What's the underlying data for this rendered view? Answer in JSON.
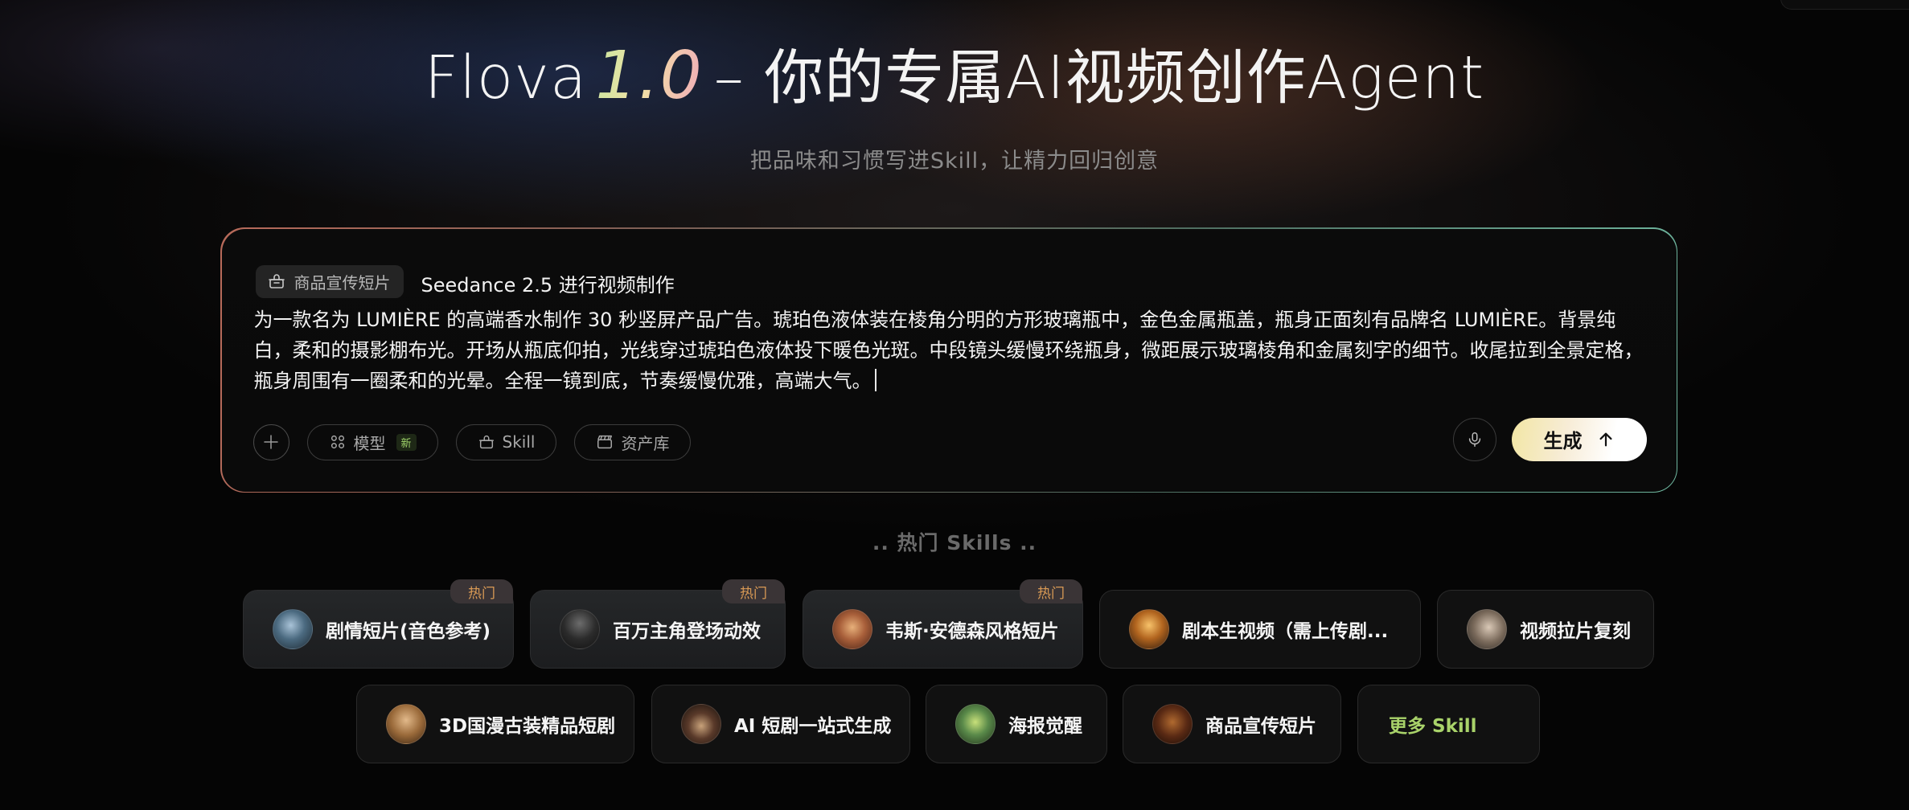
{
  "hero": {
    "brand": "Flova",
    "version": "1.0",
    "tagline": "– 你的专属AI视频创作Agent",
    "subtitle": "把品味和习惯写进Skill，让精力回归创意"
  },
  "composer": {
    "skill_chip": "商品宣传短片",
    "model_line": "Seedance 2.5 进行视频制作",
    "prompt": "为一款名为 LUMIÈRE 的高端香水制作 30 秒竖屏产品广告。琥珀色液体装在棱角分明的方形玻璃瓶中，金色金属瓶盖，瓶身正面刻有品牌名 LUMIÈRE。背景纯白，柔和的摄影棚布光。开场从瓶底仰拍，光线穿过琥珀色液体投下暖色光斑。中段镜头缓慢环绕瓶身，微距展示玻璃棱角和金属刻字的细节。收尾拉到全景定格，瓶身周围有一圈柔和的光晕。全程一镜到底，节奏缓慢优雅，高端大气。",
    "toolbar": {
      "model_label": "模型",
      "model_new_tag": "新",
      "skill_label": "Skill",
      "assets_label": "资产库"
    },
    "generate_label": "生成"
  },
  "hot_skills": {
    "header": ".. 热门 Skills ..",
    "badge": "热门",
    "row1": [
      {
        "label": "剧情短片(音色参考)",
        "hot": true
      },
      {
        "label": "百万主角登场动效",
        "hot": true
      },
      {
        "label": "韦斯·安德森风格短片",
        "hot": true
      },
      {
        "label": "剧本生视频（需上传剧...",
        "hot": false
      },
      {
        "label": "视频拉片复刻",
        "hot": false
      }
    ],
    "row2": [
      {
        "label": "3D国漫古装精品短剧"
      },
      {
        "label": "AI 短剧一站式生成"
      },
      {
        "label": "海报觉醒"
      },
      {
        "label": "商品宣传短片"
      }
    ],
    "more_label": "更多 Skill"
  },
  "colors": {
    "background": "#050505",
    "accent_green": "#a9d36a",
    "hot_badge_text": "#d99a55",
    "generate_button": "#f7ecd6"
  }
}
